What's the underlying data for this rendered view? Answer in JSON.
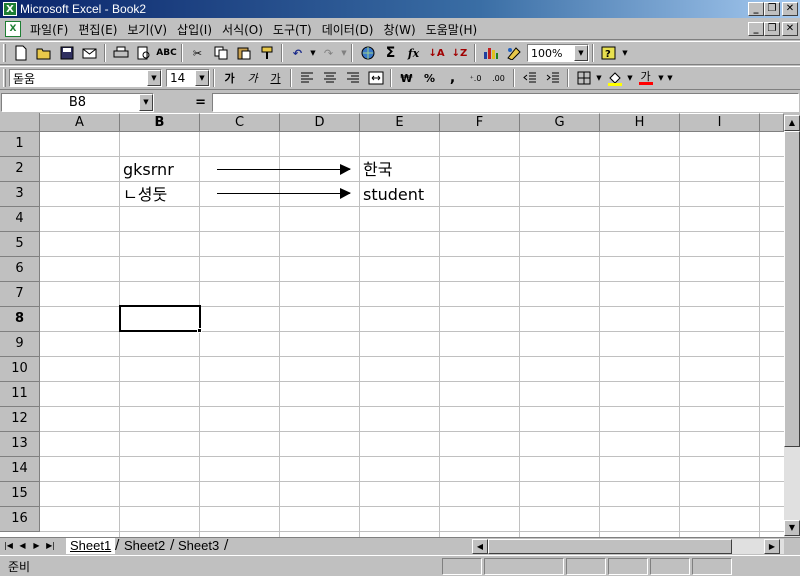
{
  "window": {
    "title": "Microsoft Excel - Book2",
    "app_icon": "X",
    "buttons": [
      "_",
      "❐",
      "✕"
    ]
  },
  "menu": {
    "items": [
      "파일(F)",
      "편집(E)",
      "보기(V)",
      "삽입(I)",
      "서식(O)",
      "도구(T)",
      "데이터(D)",
      "창(W)",
      "도움말(H)"
    ],
    "doc_buttons": [
      "_",
      "❐",
      "✕"
    ]
  },
  "toolbar": {
    "zoom": "100%"
  },
  "format_toolbar": {
    "font_name": "돋움",
    "font_size": "14",
    "bold": "가",
    "italic": "가",
    "underline": "가",
    "currency": "₩",
    "percent": "%",
    "comma": ",",
    "inc_decimal": "⁺.0",
    "dec_decimal": ".00",
    "font_color_label": "가"
  },
  "formula_bar": {
    "name_box": "B8",
    "equals": "=",
    "content": ""
  },
  "grid": {
    "columns": [
      "A",
      "B",
      "C",
      "D",
      "E",
      "F",
      "G",
      "H",
      "I"
    ],
    "rows": [
      "1",
      "2",
      "3",
      "4",
      "5",
      "6",
      "7",
      "8",
      "9",
      "10",
      "11",
      "12",
      "13",
      "14",
      "15",
      "16"
    ],
    "active_cell": "B8",
    "cells": {
      "B2": "gksrnr",
      "B3": "ㄴ셩둣",
      "E2": "한국",
      "E3": "student"
    }
  },
  "sheets": {
    "tabs": [
      "Sheet1",
      "Sheet2",
      "Sheet3"
    ],
    "active": "Sheet1"
  },
  "status": {
    "text": "준비"
  }
}
